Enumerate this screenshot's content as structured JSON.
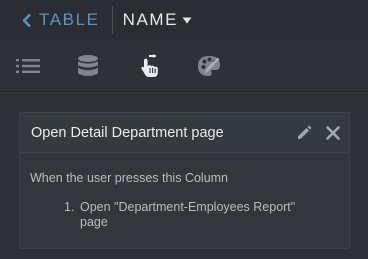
{
  "header": {
    "back_label": "TABLE",
    "name_label": "NAME"
  },
  "tabs": [
    {
      "id": "fields",
      "icon": "list-icon"
    },
    {
      "id": "data",
      "icon": "database-icon"
    },
    {
      "id": "actions",
      "icon": "tap-action-icon",
      "active": true
    },
    {
      "id": "style",
      "icon": "palette-icon"
    }
  ],
  "action_card": {
    "title": "Open Detail Department page",
    "trigger": "When the user presses this Column",
    "steps": [
      {
        "number": "1.",
        "text": "Open \"Department-Employees Report\" page"
      }
    ]
  },
  "colors": {
    "accent": "#4a90d9",
    "back_link": "#5b93c7",
    "background": "#2e3236",
    "header": "#2a2e32",
    "card": "#33373b"
  }
}
